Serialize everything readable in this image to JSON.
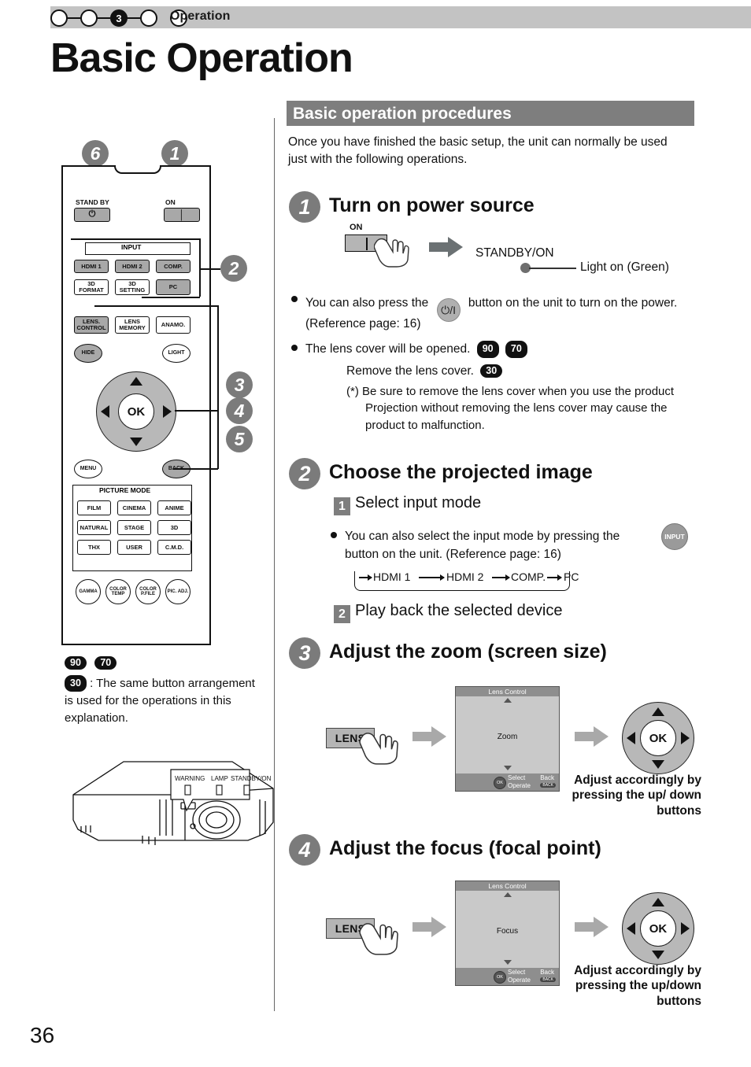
{
  "header": {
    "chapter_label": "Operation",
    "active_step": "3",
    "dots": [
      "",
      "",
      "3",
      "",
      ""
    ]
  },
  "page_title": "Basic Operation",
  "page_number": "36",
  "section": {
    "heading": "Basic operation procedures",
    "intro": "Once you have finished the basic setup, the unit can normally be used just with the following operations."
  },
  "remote": {
    "labels": {
      "standby": "STAND BY",
      "on": "ON",
      "input_group": "INPUT",
      "picture_mode_group": "PICTURE MODE"
    },
    "buttons": {
      "standby_icon": "power-icon",
      "on_icon": "bar-icon",
      "hdmi1": "HDMI 1",
      "hdmi2": "HDMI 2",
      "comp": "COMP.",
      "format3d": "3D FORMAT",
      "setting3d": "3D SETTING",
      "pc": "PC",
      "lens_control": "LENS. CONTROL",
      "lens_memory": "LENS MEMORY",
      "anamo": "ANAMO.",
      "hide": "HIDE",
      "light": "LIGHT",
      "ok": "OK",
      "menu": "MENU",
      "back": "BACK",
      "film": "FILM",
      "cinema": "CINEMA",
      "anime": "ANIME",
      "natural": "NATURAL",
      "stage": "STAGE",
      "three_d": "3D",
      "thx": "THX",
      "user": "USER",
      "cmd": "C.M.D.",
      "gamma": "GAMMA",
      "color_temp": "COLOR TEMP",
      "color_pfile": "COLOR P.FILE",
      "pic_adj": "PIC. ADJ."
    },
    "callouts": [
      "6",
      "1",
      "2",
      "3",
      "4",
      "5"
    ]
  },
  "footnote": {
    "pills": [
      "90",
      "70",
      "30"
    ],
    "text": ": The same button arrangement is used for the operations in this explanation."
  },
  "projector": {
    "indicators": [
      "WARNING",
      "LAMP",
      "STANDBY/ON"
    ]
  },
  "steps": [
    {
      "badge": "1",
      "title": "Turn on power source",
      "on_label": "ON",
      "standby_on_label": "STANDBY/ON",
      "light_on_label": "Light on (Green)",
      "bullets": [
        {
          "pre": "You can also press the",
          "icon": "power-toggle-icon",
          "icon_text": "⏻/I",
          "post": "button on the unit to turn on the power. (Reference page: 16)"
        },
        {
          "pre": "The lens cover will be opened.",
          "pills": [
            "90",
            "70"
          ]
        }
      ],
      "remove_lens": {
        "text": "Remove the lens cover.",
        "pill": "30"
      },
      "note": "(*) Be sure to remove the lens cover when you use the product Projection without removing the lens cover may cause the product to malfunction."
    },
    {
      "badge": "2",
      "title": "Choose the projected image",
      "sub1_num": "1",
      "sub1": "Select input mode",
      "bullet": "You can also select the input mode by pressing the button on the unit. (Reference page: 16)",
      "input_button_label": "INPUT",
      "cycle": [
        "HDMI 1",
        "HDMI 2",
        "COMP.",
        "PC"
      ],
      "sub2_num": "2",
      "sub2": "Play back the selected device"
    },
    {
      "badge": "3",
      "title": "Adjust the zoom (screen size)",
      "lens_button": "LENS",
      "osd": {
        "title": "Lens Control",
        "value": "Zoom",
        "select": "Select",
        "operate": "Operate",
        "back": "Back",
        "back_btn": "BACK",
        "ok": "OK"
      },
      "dpad_ok": "OK",
      "adjust_text": "Adjust accordingly by pressing the up/ down buttons"
    },
    {
      "badge": "4",
      "title": "Adjust the focus (focal point)",
      "lens_button": "LENS",
      "osd": {
        "title": "Lens Control",
        "value": "Focus",
        "select": "Select",
        "operate": "Operate",
        "back": "Back",
        "back_btn": "BACK",
        "ok": "OK"
      },
      "dpad_ok": "OK",
      "adjust_text": "Adjust accordingly by pressing the up/down buttons"
    }
  ],
  "colors": {
    "header_bar": "#c3c3c3",
    "section_bar": "#7e7e7e",
    "badge_gray": "#7b7b7b",
    "button_gray": "#a8a8a8",
    "osd_bg": "#c9c9c9"
  }
}
